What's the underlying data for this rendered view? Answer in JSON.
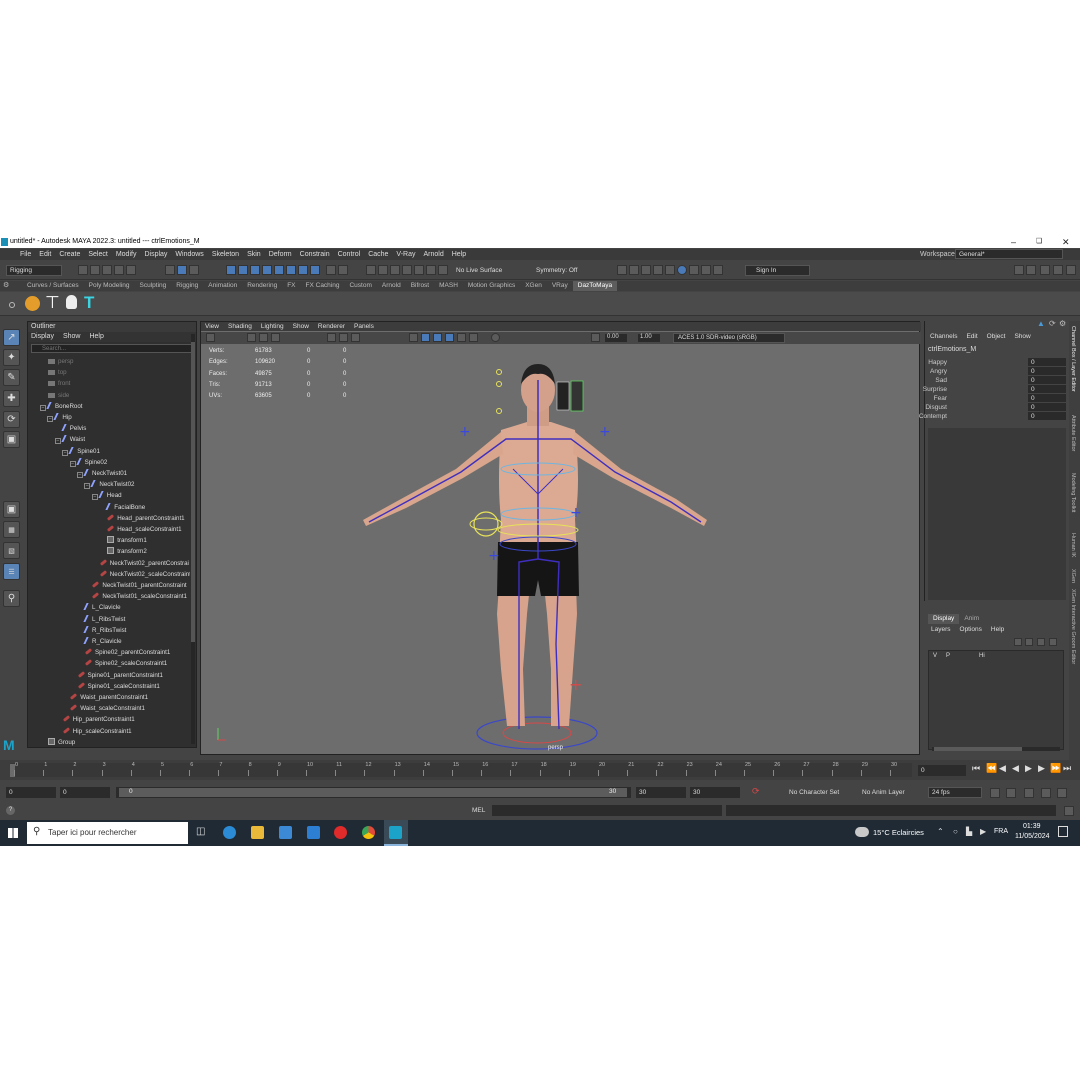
{
  "window": {
    "title": "untitled* - Autodesk MAYA 2022.3: untitled   ---   ctrlEmotions_M"
  },
  "menu": [
    "File",
    "Edit",
    "Create",
    "Select",
    "Modify",
    "Display",
    "Windows",
    "Skeleton",
    "Skin",
    "Deform",
    "Constrain",
    "Control",
    "Cache",
    "V-Ray",
    "Arnold",
    "Help"
  ],
  "workspace": {
    "label": "Workspace:",
    "value": "General*"
  },
  "status": {
    "mode": "Rigging",
    "live_surface": "No Live Surface",
    "symmetry": "Symmetry: Off",
    "sign_in": "Sign In"
  },
  "shelf_tabs": [
    "Curves / Surfaces",
    "Poly Modeling",
    "Sculpting",
    "Rigging",
    "Animation",
    "Rendering",
    "FX",
    "FX Caching",
    "Custom",
    "Arnold",
    "Bifrost",
    "MASH",
    "Motion Graphics",
    "XGen",
    "VRay",
    "DazToMaya"
  ],
  "active_shelf": "DazToMaya",
  "outliner": {
    "title": "Outliner",
    "menu": [
      "Display",
      "Show",
      "Help"
    ],
    "search_placeholder": "Search...",
    "items": [
      {
        "label": "persp",
        "depth": 0,
        "icon": "cam",
        "dim": true
      },
      {
        "label": "top",
        "depth": 0,
        "icon": "cam",
        "dim": true
      },
      {
        "label": "front",
        "depth": 0,
        "icon": "cam",
        "dim": true
      },
      {
        "label": "side",
        "depth": 0,
        "icon": "cam",
        "dim": true
      },
      {
        "label": "BoneRoot",
        "depth": 0,
        "icon": "joint"
      },
      {
        "label": "Hip",
        "depth": 1,
        "icon": "joint"
      },
      {
        "label": "Pelvis",
        "depth": 2,
        "icon": "joint"
      },
      {
        "label": "Waist",
        "depth": 2,
        "icon": "joint"
      },
      {
        "label": "Spine01",
        "depth": 3,
        "icon": "joint"
      },
      {
        "label": "Spine02",
        "depth": 4,
        "icon": "joint"
      },
      {
        "label": "NeckTwist01",
        "depth": 5,
        "icon": "joint"
      },
      {
        "label": "NeckTwist02",
        "depth": 6,
        "icon": "joint"
      },
      {
        "label": "Head",
        "depth": 7,
        "icon": "joint"
      },
      {
        "label": "FacialBone",
        "depth": 8,
        "icon": "joint"
      },
      {
        "label": "Head_parentConstraint1",
        "depth": 8,
        "icon": "cons"
      },
      {
        "label": "Head_scaleConstraint1",
        "depth": 8,
        "icon": "cons"
      },
      {
        "label": "transform1",
        "depth": 8,
        "icon": "xf"
      },
      {
        "label": "transform2",
        "depth": 8,
        "icon": "xf"
      },
      {
        "label": "NeckTwist02_parentConstrai",
        "depth": 7,
        "icon": "cons"
      },
      {
        "label": "NeckTwist02_scaleConstraint",
        "depth": 7,
        "icon": "cons"
      },
      {
        "label": "NeckTwist01_parentConstraint",
        "depth": 6,
        "icon": "cons"
      },
      {
        "label": "NeckTwist01_scaleConstraint1",
        "depth": 6,
        "icon": "cons"
      },
      {
        "label": "L_Clavicle",
        "depth": 5,
        "icon": "joint"
      },
      {
        "label": "L_RibsTwist",
        "depth": 5,
        "icon": "joint"
      },
      {
        "label": "R_RibsTwist",
        "depth": 5,
        "icon": "joint"
      },
      {
        "label": "R_Clavicle",
        "depth": 5,
        "icon": "joint"
      },
      {
        "label": "Spine02_parentConstraint1",
        "depth": 5,
        "icon": "cons"
      },
      {
        "label": "Spine02_scaleConstraint1",
        "depth": 5,
        "icon": "cons"
      },
      {
        "label": "Spine01_parentConstraint1",
        "depth": 4,
        "icon": "cons"
      },
      {
        "label": "Spine01_scaleConstraint1",
        "depth": 4,
        "icon": "cons"
      },
      {
        "label": "Waist_parentConstraint1",
        "depth": 3,
        "icon": "cons"
      },
      {
        "label": "Waist_scaleConstraint1",
        "depth": 3,
        "icon": "cons"
      },
      {
        "label": "Hip_parentConstraint1",
        "depth": 2,
        "icon": "cons"
      },
      {
        "label": "Hip_scaleConstraint1",
        "depth": 2,
        "icon": "cons"
      },
      {
        "label": "Group",
        "depth": 0,
        "icon": "xf"
      }
    ]
  },
  "viewport": {
    "menu": [
      "View",
      "Shading",
      "Lighting",
      "Show",
      "Renderer",
      "Panels"
    ],
    "field_a": "0.00",
    "field_b": "1.00",
    "colorspace": "ACES 1.0 SDR-video (sRGB)",
    "camera": "persp",
    "hud": [
      {
        "label": "Verts:",
        "v1": "61783",
        "v2": "0",
        "v3": "0"
      },
      {
        "label": "Edges:",
        "v1": "109620",
        "v2": "0",
        "v3": "0"
      },
      {
        "label": "Faces:",
        "v1": "49875",
        "v2": "0",
        "v3": "0"
      },
      {
        "label": "Tris:",
        "v1": "91713",
        "v2": "0",
        "v3": "0"
      },
      {
        "label": "UVs:",
        "v1": "63605",
        "v2": "0",
        "v3": "0"
      }
    ]
  },
  "channel_box": {
    "menu": [
      "Channels",
      "Edit",
      "Object",
      "Show"
    ],
    "object": "ctrlEmotions_M",
    "channels": [
      {
        "name": "Happy",
        "value": "0"
      },
      {
        "name": "Angry",
        "value": "0"
      },
      {
        "name": "Sad",
        "value": "0"
      },
      {
        "name": "Surprise",
        "value": "0"
      },
      {
        "name": "Fear",
        "value": "0"
      },
      {
        "name": "Disgust",
        "value": "0"
      },
      {
        "name": "Contempt",
        "value": "0"
      }
    ]
  },
  "layer_editor": {
    "tabs": [
      "Display",
      "Anim"
    ],
    "menu": [
      "Layers",
      "Options",
      "Help"
    ],
    "layer": {
      "v": "V",
      "p": "P",
      "name": "Hi"
    }
  },
  "side_tabs": [
    "Channel Box / Layer Editor",
    "Attribute Editor",
    "Modeling Toolkit",
    "Human IK",
    "XGen",
    "XGen Interactive Groom Editor"
  ],
  "timeline": {
    "ticks": [
      "0",
      "1",
      "2",
      "3",
      "4",
      "5",
      "6",
      "7",
      "8",
      "9",
      "10",
      "11",
      "12",
      "13",
      "14",
      "15",
      "16",
      "17",
      "18",
      "19",
      "20",
      "21",
      "22",
      "23",
      "24",
      "25",
      "26",
      "27",
      "28",
      "29",
      "30"
    ],
    "current_frame": "0"
  },
  "range": {
    "start": "0",
    "inner_start": "0",
    "slider_start": "0",
    "slider_end": "30",
    "inner_end": "30",
    "end": "30",
    "character_set": "No Character Set",
    "anim_layer": "No Anim Layer",
    "fps": "24 fps"
  },
  "cmdline": {
    "label": "MEL"
  },
  "taskbar": {
    "search": "Taper ici pour rechercher",
    "weather": "15°C  Eclaircies",
    "lang": "FRA",
    "time": "01:39",
    "date": "11/05/2024"
  }
}
